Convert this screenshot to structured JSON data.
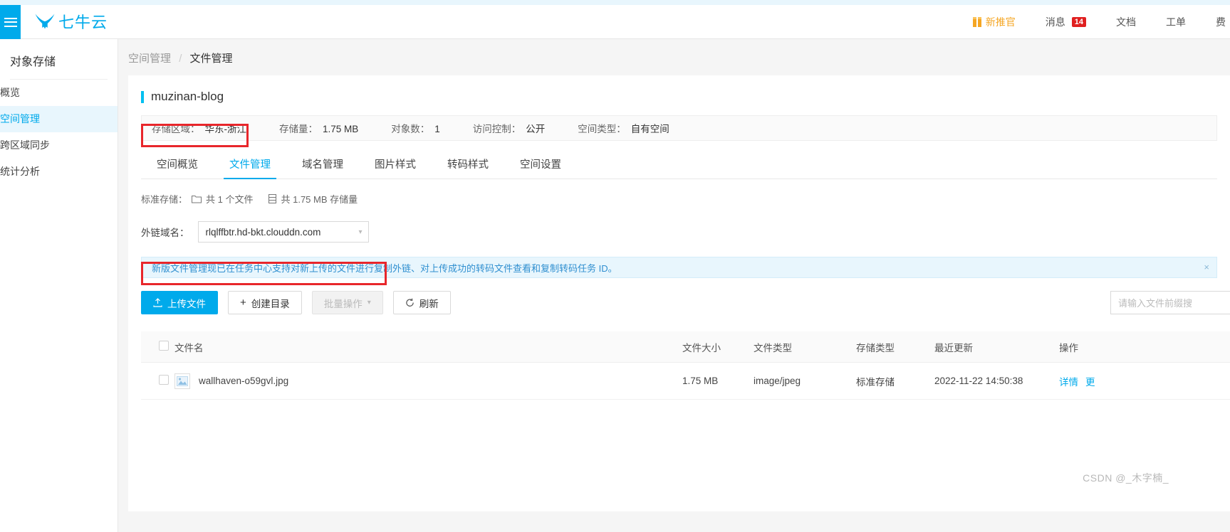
{
  "header": {
    "menu_icon": "hamburger-icon",
    "brand": "七牛云",
    "nav": [
      {
        "label": "新推官",
        "icon": "gift-icon",
        "badge": null
      },
      {
        "label": "消息",
        "icon": null,
        "badge": "14"
      },
      {
        "label": "文档",
        "icon": null,
        "badge": null
      },
      {
        "label": "工单",
        "icon": null,
        "badge": null
      },
      {
        "label": "费",
        "icon": null,
        "badge": null
      }
    ]
  },
  "sidebar": {
    "title": "对象存储",
    "items": [
      {
        "label": "概览",
        "active": false
      },
      {
        "label": "空间管理",
        "active": true
      },
      {
        "label": "跨区域同步",
        "active": false
      },
      {
        "label": "统计分析",
        "active": false
      }
    ]
  },
  "breadcrumb": {
    "parent": "空间管理",
    "separator": "/",
    "current": "文件管理"
  },
  "bucket": {
    "name": "muzinan-blog",
    "info": [
      {
        "label": "存储区域：",
        "value": "华东-浙江"
      },
      {
        "label": "存储量：",
        "value": "1.75 MB"
      },
      {
        "label": "对象数：",
        "value": "1"
      },
      {
        "label": "访问控制：",
        "value": "公开"
      },
      {
        "label": "空间类型：",
        "value": "自有空间"
      }
    ]
  },
  "tabs": [
    {
      "label": "空间概览",
      "active": false
    },
    {
      "label": "文件管理",
      "active": true
    },
    {
      "label": "域名管理",
      "active": false
    },
    {
      "label": "图片样式",
      "active": false
    },
    {
      "label": "转码样式",
      "active": false
    },
    {
      "label": "空间设置",
      "active": false
    }
  ],
  "storage_summary": {
    "prefix": "标准存储：",
    "files_text": "共 1 个文件",
    "size_text": "共 1.75 MB 存储量"
  },
  "domain": {
    "label": "外链域名：",
    "value": "rlqlffbtr.hd-bkt.clouddn.com"
  },
  "notice": {
    "text": "新版文件管理现已在任务中心支持对新上传的文件进行复制外链、对上传成功的转码文件查看和复制转码任务 ID。",
    "close": "×"
  },
  "toolbar": {
    "upload": "上传文件",
    "create_dir": "创建目录",
    "batch": "批量操作",
    "refresh": "刷新",
    "search_placeholder": "请输入文件前缀搜"
  },
  "table": {
    "columns": [
      "文件名",
      "文件大小",
      "文件类型",
      "存储类型",
      "最近更新",
      "操作"
    ],
    "rows": [
      {
        "name": "wallhaven-o59gvl.jpg",
        "size": "1.75 MB",
        "type": "image/jpeg",
        "storage": "标准存储",
        "updated": "2022-11-22 14:50:38",
        "actions": [
          "详情",
          "更"
        ]
      }
    ]
  },
  "watermark": "CSDN @_木字楠_",
  "colors": {
    "accent": "#00aaeb",
    "annotation": "#e8262b",
    "badge": "#e02020",
    "promo": "#f5a623"
  }
}
